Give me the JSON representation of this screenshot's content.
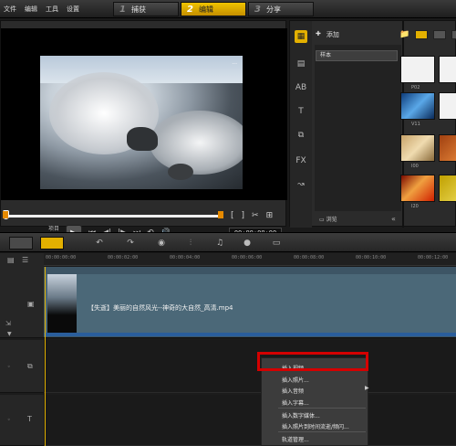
{
  "menu": [
    "文件",
    "编辑",
    "工具",
    "设置"
  ],
  "steps": [
    {
      "num": "1",
      "label": "捕获",
      "active": false
    },
    {
      "num": "2",
      "label": "编辑",
      "active": true
    },
    {
      "num": "3",
      "label": "分享",
      "active": false
    }
  ],
  "player": {
    "watermark": "...",
    "mode_top": "项目",
    "mode_bottom": "素材",
    "bracket_in": "[",
    "bracket_out": "]",
    "timecode": "00:00:00:00",
    "play_icon": "▶",
    "transport_icons": [
      "⏮",
      "◀|",
      "|▶",
      "⏭",
      "⟲",
      "🔊"
    ]
  },
  "library": {
    "add_label": "添加",
    "sample_label": "样本",
    "browse_label": "浏览",
    "thumbs": [
      {
        "label": "P02"
      },
      {
        "label": "V11"
      },
      {
        "label": "I00"
      },
      {
        "label": "I20"
      }
    ]
  },
  "ruler_ticks": [
    "00:00:00:00",
    "00:00:02:00",
    "00:00:04:00",
    "00:00:06:00",
    "00:00:08:00",
    "00:00:10:00",
    "00:00:12:00"
  ],
  "video_track": {
    "clip_title": "【失逝】美丽的自然风光--神奇的大自然_高清.mp4"
  },
  "context_menu": {
    "items": [
      "插入视频...",
      "插入照片...",
      "插入音频",
      "插入字幕...",
      "插入数字媒体...",
      "插入照片到时间流逝/频闪...",
      "轨道管理..."
    ],
    "highlight_color": "#d40000"
  },
  "colors": {
    "accent": "#e3b000",
    "track_blue": "#3d5565"
  }
}
